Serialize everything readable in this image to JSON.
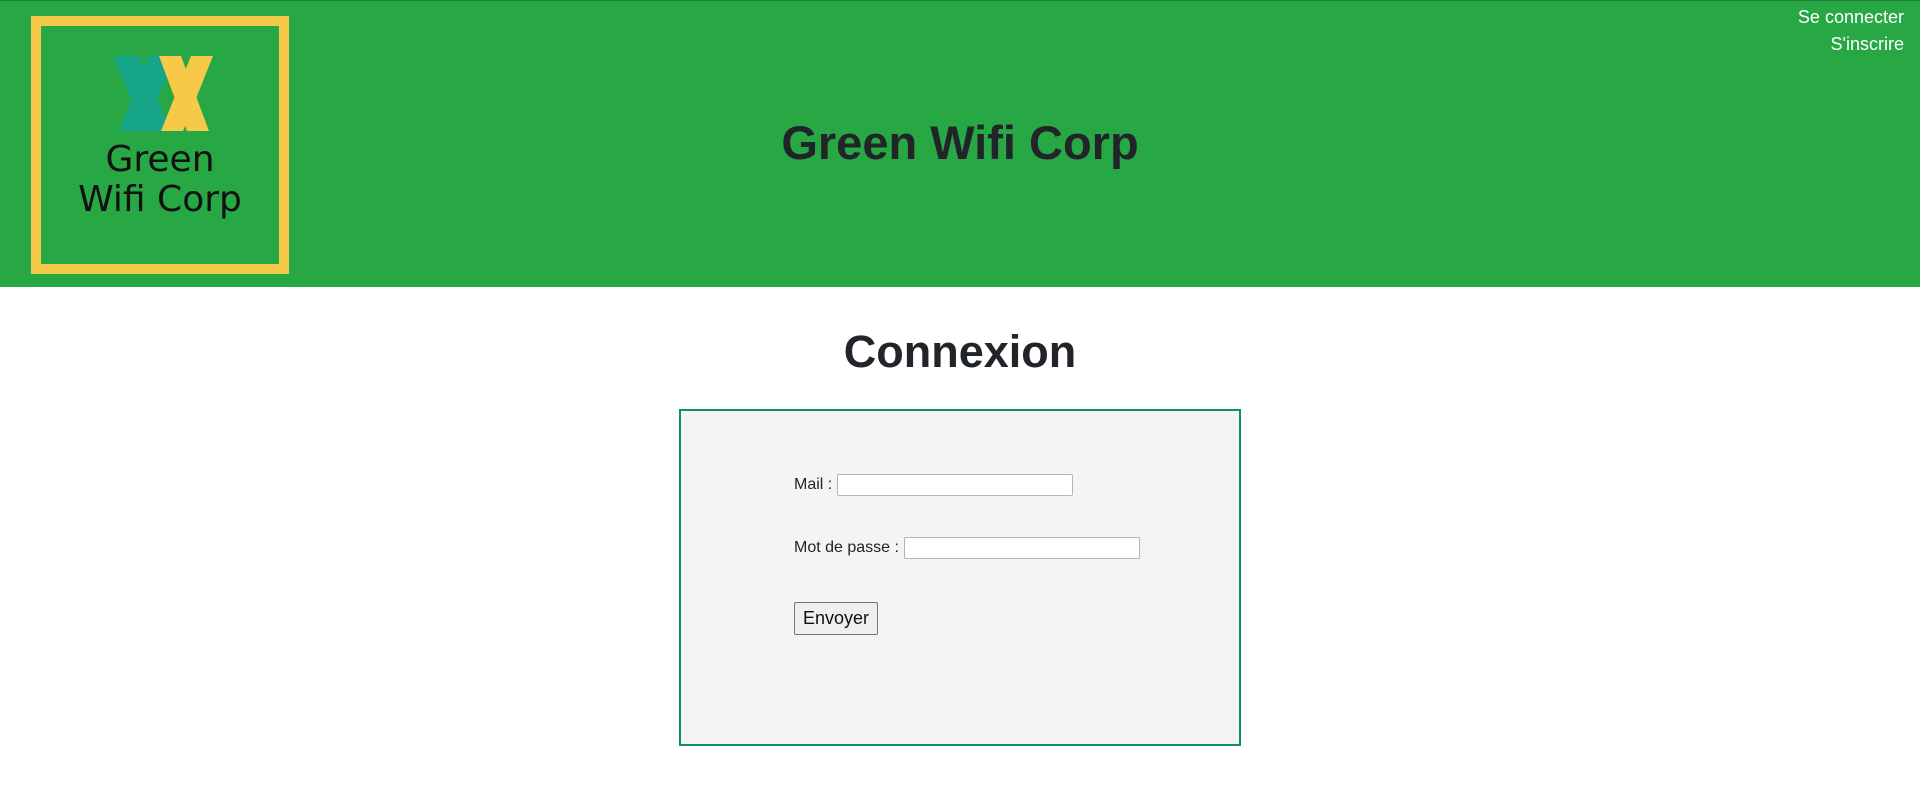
{
  "header": {
    "title": "Green Wifi Corp",
    "logo": {
      "text_line1": "Green",
      "text_line2": "Wifi Corp",
      "colors": {
        "border": "#f7c948",
        "teal": "#17a589",
        "yellow": "#f7c948"
      }
    },
    "links": {
      "login": "Se connecter",
      "register": "S'inscrire"
    },
    "background": "#28a745"
  },
  "main": {
    "heading": "Connexion",
    "form": {
      "mail_label": "Mail :",
      "mail_value": "",
      "password_label": "Mot de passe :",
      "password_value": "",
      "submit_label": "Envoyer",
      "border_color": "#138a72",
      "background": "#f4f4f4"
    }
  }
}
